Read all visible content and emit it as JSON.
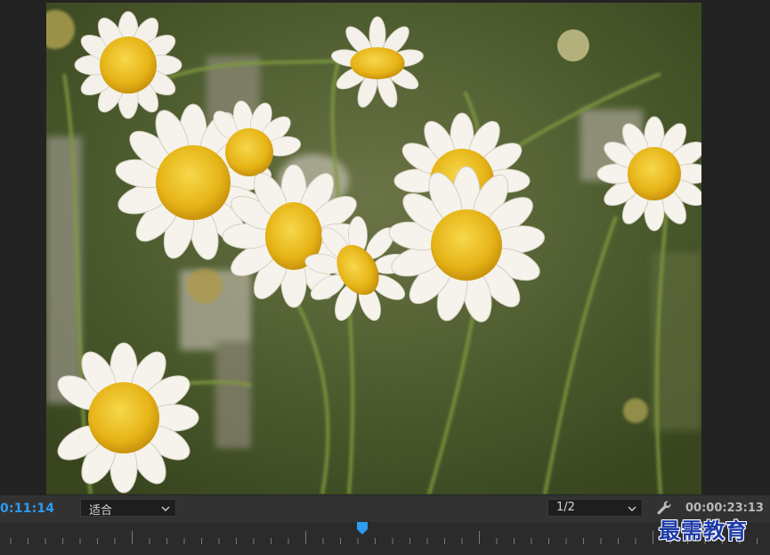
{
  "viewer": {
    "frame_image": "daisies-photo"
  },
  "controls": {
    "current_time": "0:11:14",
    "zoom_value": "适合",
    "resolution_value": "1/2",
    "total_time": "00:00:23:13",
    "settings_icon": "wrench-icon",
    "dropdown_icon": "chevron-down-icon"
  },
  "ruler": {
    "playhead_icon": "playhead-icon",
    "playhead_position_fraction": 0.47
  },
  "watermark": {
    "text": "最需教育"
  },
  "colors": {
    "accent_blue": "#2d9cf2",
    "panel_bg": "#323232",
    "viewer_bg": "#232323"
  }
}
